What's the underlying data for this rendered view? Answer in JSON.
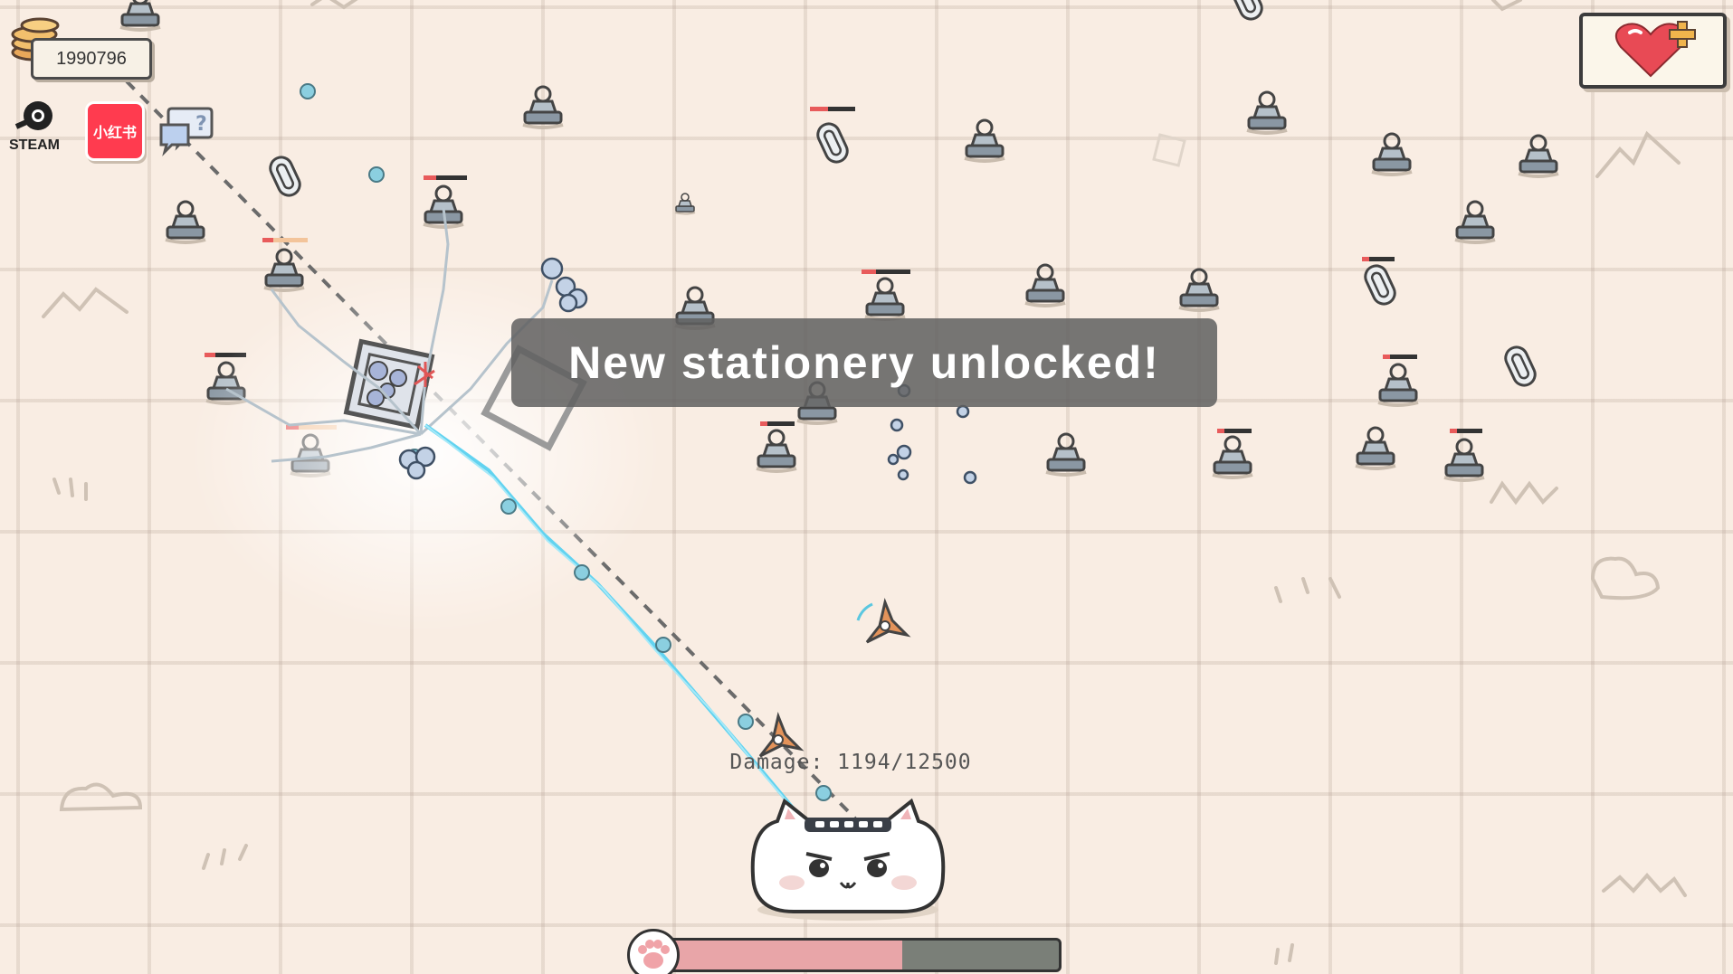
{
  "hud": {
    "coins": "1990796",
    "steam_label": "STEAM",
    "xhs_label": "小红书",
    "help_symbol": "?"
  },
  "toast": {
    "message": "New stationery unlocked!"
  },
  "boss": {
    "damage_text": "Damage: 1194/12500",
    "damage_done": 1194,
    "damage_total": 12500
  },
  "player": {
    "health_fraction": 0.6
  },
  "icons": {
    "coin": "coin-stack-icon",
    "steam": "steam-icon",
    "xhs": "xiaohongshu-icon",
    "help": "help-chat-icon",
    "heart": "heart-plus-icon",
    "paw": "paw-icon"
  },
  "colors": {
    "background": "#f9ede3",
    "enemy_gray": "#8a97a3",
    "laser": "#62d3f0",
    "toast_bg": "#5f5f5f",
    "health_fill": "#e8a5a8",
    "heart_red": "#e84a55"
  }
}
